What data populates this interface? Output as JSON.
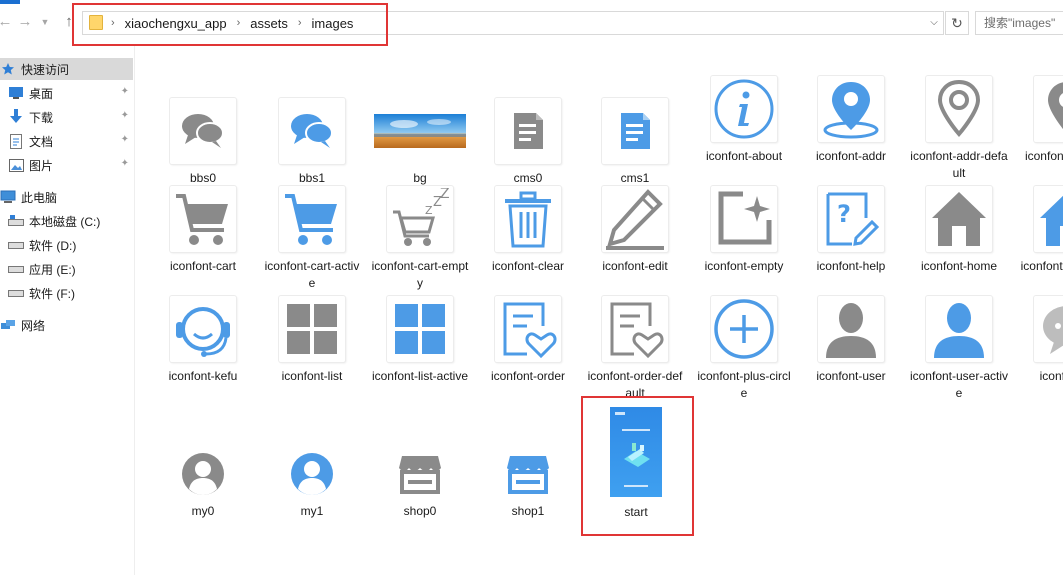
{
  "address": {
    "crumbs": [
      "xiaochengxu_app",
      "assets",
      "images"
    ]
  },
  "search": {
    "placeholder": "搜索\"images\""
  },
  "sidebar": {
    "quick_access": "快速访问",
    "pinned": [
      {
        "label": "桌面",
        "icon": "desktop-icon"
      },
      {
        "label": "下载",
        "icon": "download-icon"
      },
      {
        "label": "文档",
        "icon": "documents-icon"
      },
      {
        "label": "图片",
        "icon": "pictures-icon"
      }
    ],
    "this_pc": "此电脑",
    "drives": [
      {
        "label": "本地磁盘 (C:)"
      },
      {
        "label": "软件 (D:)"
      },
      {
        "label": "应用 (E:)"
      },
      {
        "label": "软件 (F:)"
      }
    ],
    "network": "网络"
  },
  "files": [
    {
      "name": "bbs0",
      "icon": "chat-bubbles-icon",
      "color": "#8a8a8a"
    },
    {
      "name": "bbs1",
      "icon": "chat-bubbles-icon",
      "color": "#4d9be6"
    },
    {
      "name": "bg",
      "icon": "landscape-image-icon"
    },
    {
      "name": "cms0",
      "icon": "document-icon",
      "color": "#8a8a8a"
    },
    {
      "name": "cms1",
      "icon": "document-icon",
      "color": "#4d9be6"
    },
    {
      "name": "iconfont-about",
      "icon": "info-circle-icon",
      "color": "#4d9be6"
    },
    {
      "name": "iconfont-addr",
      "icon": "location-pin-icon",
      "color": "#4d9be6"
    },
    {
      "name": "iconfont-addr-default",
      "icon": "location-pin-icon",
      "color": "#8a8a8a"
    },
    {
      "name": "iconfont-addr-m",
      "icon": "location-pin-icon",
      "color": "#8a8a8a"
    },
    {
      "name": "iconfont-cart",
      "icon": "cart-icon",
      "color": "#8a8a8a"
    },
    {
      "name": "iconfont-cart-active",
      "icon": "cart-icon",
      "color": "#4d9be6"
    },
    {
      "name": "iconfont-cart-empty",
      "icon": "cart-empty-icon",
      "color": "#8a8a8a"
    },
    {
      "name": "iconfont-clear",
      "icon": "trash-icon",
      "color": "#4d9be6"
    },
    {
      "name": "iconfont-edit",
      "icon": "pencil-icon",
      "color": "#8a8a8a"
    },
    {
      "name": "iconfont-empty",
      "icon": "sparkle-frame-icon",
      "color": "#8a8a8a"
    },
    {
      "name": "iconfont-help",
      "icon": "help-icon",
      "color": "#4d9be6"
    },
    {
      "name": "iconfont-home",
      "icon": "home-icon",
      "color": "#8a8a8a"
    },
    {
      "name": "iconfont-home-ac",
      "icon": "home-icon",
      "color": "#4d9be6"
    },
    {
      "name": "iconfont-kefu",
      "icon": "headset-icon",
      "color": "#4d9be6"
    },
    {
      "name": "iconfont-list",
      "icon": "grid-icon",
      "color": "#8a8a8a"
    },
    {
      "name": "iconfont-list-active",
      "icon": "grid-icon",
      "color": "#4d9be6"
    },
    {
      "name": "iconfont-order",
      "icon": "order-heart-icon",
      "color": "#4d9be6"
    },
    {
      "name": "iconfont-order-default",
      "icon": "order-heart-icon",
      "color": "#8a8a8a"
    },
    {
      "name": "iconfont-plus-circle",
      "icon": "plus-circle-icon",
      "color": "#4d9be6"
    },
    {
      "name": "iconfont-user",
      "icon": "user-icon",
      "color": "#8a8a8a"
    },
    {
      "name": "iconfont-user-active",
      "icon": "user-icon",
      "color": "#4d9be6"
    },
    {
      "name": "iconfont-w",
      "icon": "chat-icon",
      "color": "#bdbdbd"
    },
    {
      "name": "my0",
      "icon": "avatar-circle-icon",
      "color": "#8a8a8a"
    },
    {
      "name": "my1",
      "icon": "avatar-circle-icon",
      "color": "#4d9be6"
    },
    {
      "name": "shop0",
      "icon": "shop-icon",
      "color": "#8a8a8a"
    },
    {
      "name": "shop1",
      "icon": "shop-icon",
      "color": "#4d9be6"
    },
    {
      "name": "start",
      "icon": "splash-image-icon",
      "color": "#2f8ae6"
    }
  ]
}
